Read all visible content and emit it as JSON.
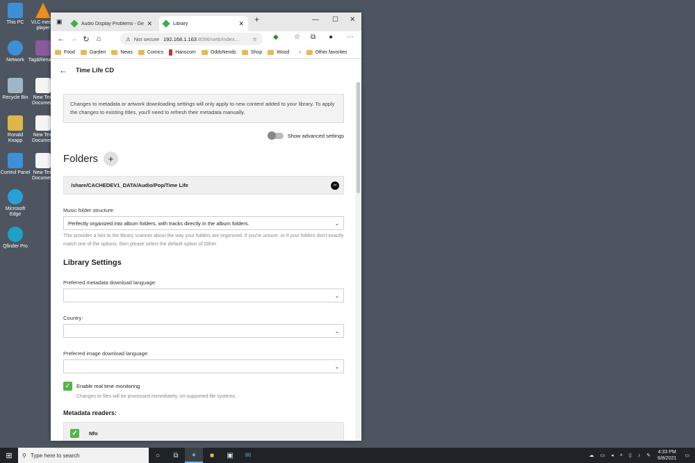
{
  "desktop": {
    "icons": [
      {
        "label": "This PC",
        "color": "#3d8fd6"
      },
      {
        "label": "VLC media player",
        "color": "#f08c1a"
      },
      {
        "label": "Network",
        "color": "#3d8fd6"
      },
      {
        "label": "Tag&Rename",
        "color": "#8a5a9e"
      },
      {
        "label": "Recycle Bin",
        "color": "#9fb6c8"
      },
      {
        "label": "New Text Document",
        "color": "#f5f5f5"
      },
      {
        "label": "Ronald Knapp",
        "color": "#e0b64a"
      },
      {
        "label": "New Text Document",
        "color": "#f5f5f5"
      },
      {
        "label": "Control Panel",
        "color": "#3d8fd6"
      },
      {
        "label": "New Text Document",
        "color": "#f5f5f5"
      },
      {
        "label": "Microsoft Edge",
        "color": "#2aa0d8"
      },
      {
        "label": "Qfinder Pro",
        "color": "#1ba3c6"
      }
    ]
  },
  "browser": {
    "tabs": [
      {
        "title": "Audio Display Problems - General"
      },
      {
        "title": "Library"
      }
    ],
    "address": {
      "security": "Not secure",
      "host": "192.168.1.163",
      "rest": ":8096/web/index..."
    },
    "bookmarks": [
      "Food",
      "Garden",
      "News",
      "Comics",
      "Hanscom",
      "OddsNends",
      "Shop",
      "Wood"
    ],
    "other_favorites": "Other favorites"
  },
  "page": {
    "title": "Time Life CD",
    "notice": "Changes to metadata or artwork downloading settings will only apply to new content added to your library. To apply the changes to existing titles, you'll need to refresh their metadata manually.",
    "advanced_label": "Show advanced settings",
    "folders_heading": "Folders",
    "folder_path": "/share/CACHEDEV1_DATA/Audio/Pop/Time Life",
    "music_structure_label": "Music folder structure:",
    "music_structure_value": "Perfectly organized into album folders, with tracks directly in the album folders.",
    "music_structure_hint": "This provides a hint to the library scanner about the way your folders are organized. If you're unsure, or if your folders don't exactly match one of the options, then please select the default option of Other.",
    "library_settings_heading": "Library Settings",
    "metadata_lang_label": "Preferred metadata download language:",
    "country_label": "Country:",
    "image_lang_label": "Preferred image download language:",
    "realtime_label": "Enable real time monitoring",
    "realtime_hint": "Changes to files will be processed immediately, on supported file systems.",
    "metadata_readers_heading": "Metadata readers:",
    "reader_nfo": "Nfo"
  },
  "taskbar": {
    "search_placeholder": "Type here to search",
    "time": "4:33 PM",
    "date": "6/8/2021"
  }
}
